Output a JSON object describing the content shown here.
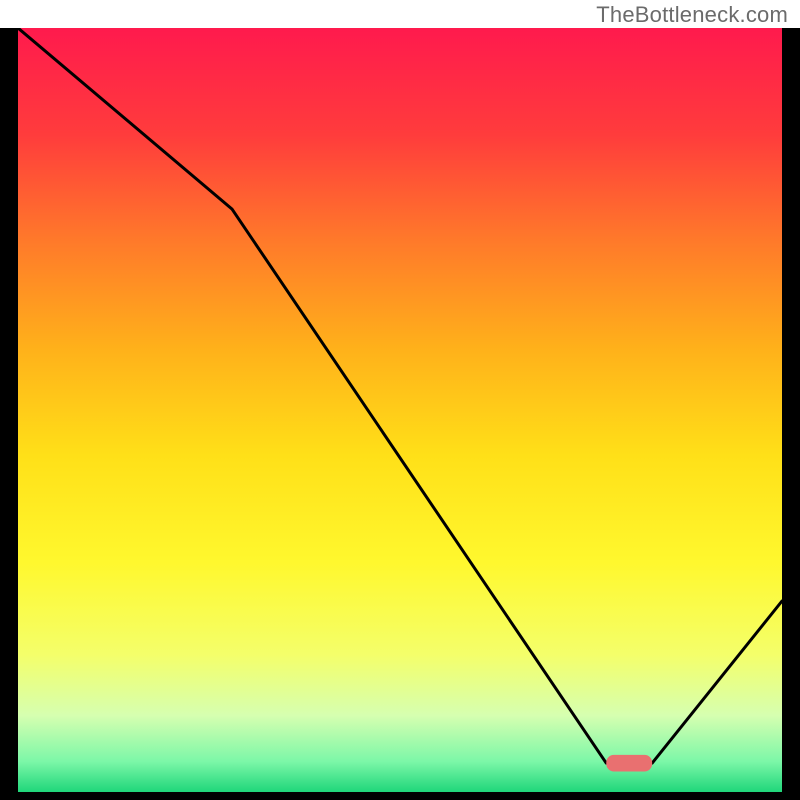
{
  "watermark": "TheBottleneck.com",
  "chart_data": {
    "type": "line",
    "title": "",
    "xlabel": "",
    "ylabel": "",
    "xlim": [
      0,
      100
    ],
    "ylim": [
      0,
      100
    ],
    "gradient": {
      "description": "vertical green-yellow-red bottleneck heat gradient",
      "stops": [
        {
          "pos": 0.0,
          "color": "#ff1a4d"
        },
        {
          "pos": 0.14,
          "color": "#ff3c3c"
        },
        {
          "pos": 0.28,
          "color": "#ff7a2a"
        },
        {
          "pos": 0.42,
          "color": "#ffb11a"
        },
        {
          "pos": 0.56,
          "color": "#ffe018"
        },
        {
          "pos": 0.7,
          "color": "#fff82e"
        },
        {
          "pos": 0.82,
          "color": "#f4ff6a"
        },
        {
          "pos": 0.9,
          "color": "#d6ffb0"
        },
        {
          "pos": 0.96,
          "color": "#7cf7a8"
        },
        {
          "pos": 1.0,
          "color": "#1fd67a"
        }
      ]
    },
    "series": [
      {
        "name": "bottleneck-curve",
        "x": [
          0,
          28,
          77,
          83,
          100
        ],
        "values": [
          100,
          76,
          2.5,
          2.5,
          24
        ]
      }
    ],
    "marker": {
      "name": "optimal-range",
      "shape": "rounded-bar",
      "color": "#e97070",
      "x_start": 77,
      "x_end": 83,
      "y": 2.5
    }
  }
}
